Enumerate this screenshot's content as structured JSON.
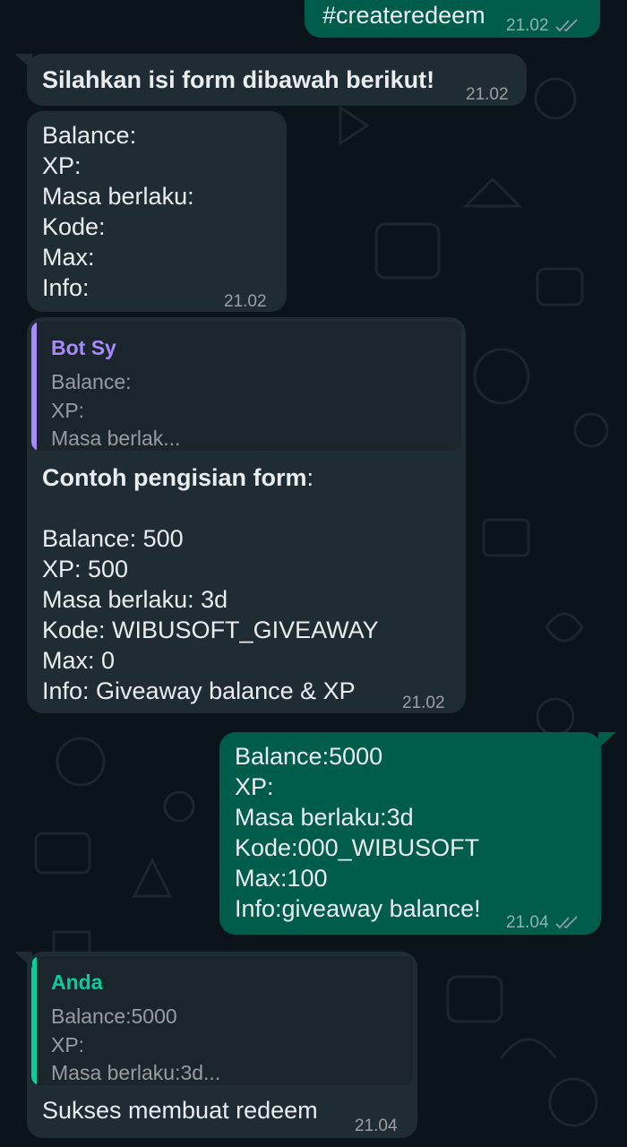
{
  "colors": {
    "background": "#0b141a",
    "incoming_bubble": "#1f2c34",
    "outgoing_bubble": "#005c4b",
    "quote_bot_accent": "#a78bfa",
    "quote_you_accent": "#06cf9c",
    "read_ticks": "#8696a0"
  },
  "messages": {
    "m0": {
      "text": "#createredeem",
      "time": "21.02",
      "status": "read-ticks-icon"
    },
    "m1": {
      "text": "Silahkan isi form dibawah berikut!",
      "time": "21.02"
    },
    "m2": {
      "lines": [
        "Balance:",
        "XP:",
        "Masa berlaku:",
        "Kode:",
        "Max:",
        "Info:"
      ],
      "time": "21.02"
    },
    "m3": {
      "quote": {
        "author": "Bot Sy",
        "lines": [
          "Balance:",
          "XP:",
          "Masa berlak..."
        ]
      },
      "heading": "Contoh pengisian form",
      "heading_suffix": ":",
      "lines": [
        "Balance: 500",
        "XP: 500",
        "Masa berlaku: 3d",
        "Kode: WIBUSOFT_GIVEAWAY",
        "Max: 0",
        "Info: Giveaway balance & XP"
      ],
      "time": "21.02"
    },
    "m4": {
      "lines": [
        "Balance:5000",
        "XP:",
        "Masa berlaku:3d",
        "Kode:000_WIBUSOFT",
        "Max:100",
        "Info:giveaway balance!"
      ],
      "time": "21.04",
      "status": "read-ticks-icon"
    },
    "m5": {
      "quote": {
        "author": "Anda",
        "lines": [
          "Balance:5000",
          "XP:",
          "Masa berlaku:3d..."
        ]
      },
      "text": "Sukses membuat redeem",
      "time": "21.04"
    }
  }
}
